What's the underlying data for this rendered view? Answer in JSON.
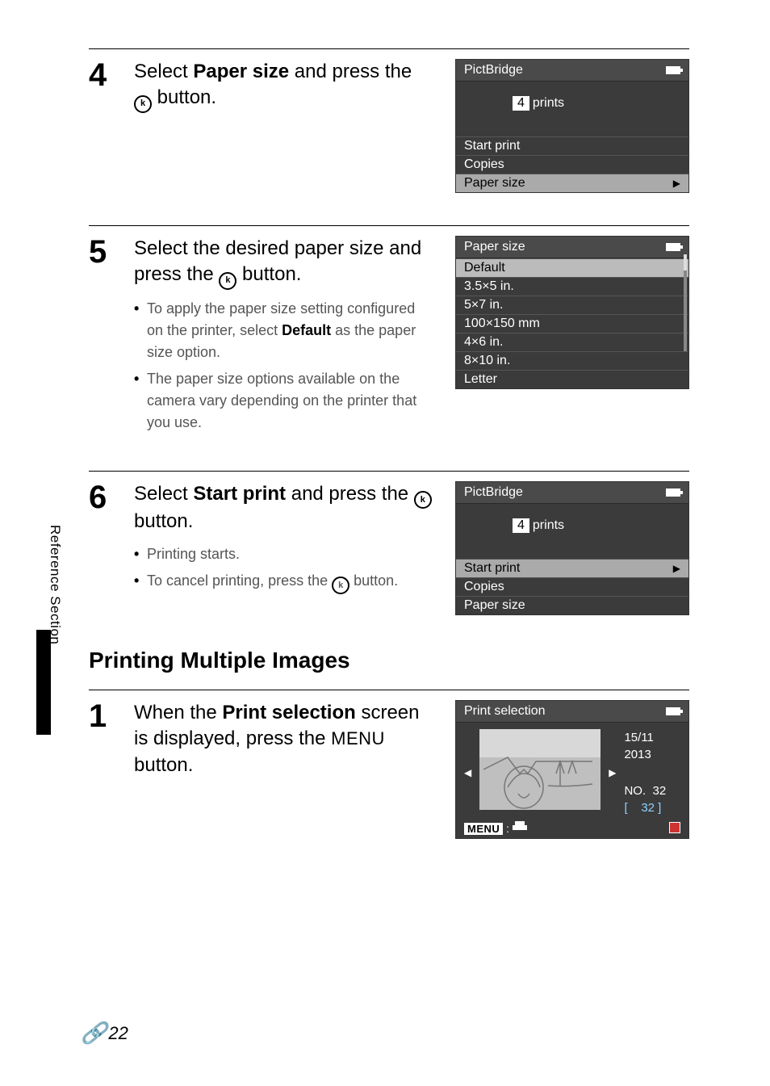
{
  "side_label": "Reference Section",
  "page_number": "22",
  "steps": {
    "s4": {
      "num": "4",
      "title_pre": "Select ",
      "title_bold": "Paper size",
      "title_mid": " and press the ",
      "title_ok": "k",
      "title_post": " button."
    },
    "s5": {
      "num": "5",
      "title_pre": "Select the desired paper size and press the ",
      "title_ok": "k",
      "title_post": " button.",
      "b1_pre": "To apply the paper size setting configured on the printer, select ",
      "b1_bold": "Default",
      "b1_post": " as the paper size option.",
      "b2": "The paper size options available on the camera vary depending on the printer that you use."
    },
    "s6": {
      "num": "6",
      "title_pre": "Select ",
      "title_bold": "Start print",
      "title_mid": " and press the ",
      "title_ok": "k",
      "title_post": " button.",
      "b1": "Printing starts.",
      "b2_pre": "To cancel printing, press the ",
      "b2_ok": "k",
      "b2_post": " button."
    }
  },
  "heading": "Printing Multiple Images",
  "sub": {
    "s1": {
      "num": "1",
      "title_pre": "When the ",
      "title_bold": "Print selection",
      "title_mid": " screen is displayed, press the ",
      "title_menu": "MENU",
      "title_post": " button."
    }
  },
  "screen1": {
    "header": "PictBridge",
    "count": "4",
    "count_label": "prints",
    "r1": "Start print",
    "r2": "Copies",
    "r3": "Paper size"
  },
  "screen2": {
    "header": "Paper size",
    "opts": [
      "Default",
      "3.5×5 in.",
      "5×7 in.",
      "100×150 mm",
      "4×6 in.",
      "8×10 in.",
      "Letter"
    ]
  },
  "screen3": {
    "header": "PictBridge",
    "count": "4",
    "count_label": "prints",
    "r1": "Start print",
    "r2": "Copies",
    "r3": "Paper size"
  },
  "screen4": {
    "header": "Print selection",
    "date1": "15/11",
    "date2": "2013",
    "no_label": "NO.",
    "no_val": "32",
    "total": "32",
    "menu": "MENU"
  }
}
